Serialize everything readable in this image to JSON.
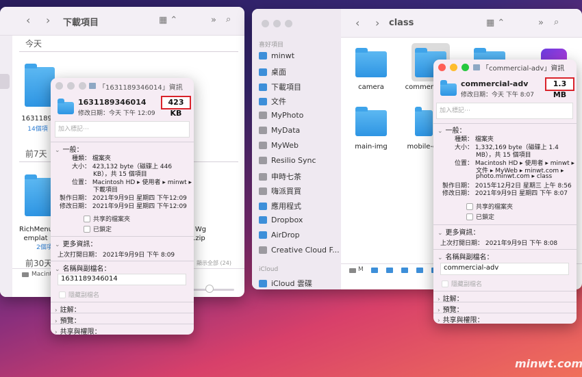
{
  "watermark": "minwt.com",
  "left_finder": {
    "title": "下載項目",
    "group_today": "今天",
    "group_7days": "前7天",
    "group_30days": "前30天",
    "file1_name": "163118934",
    "file1_sub": "14個項",
    "file2_name_a": "RichMenu_",
    "file2_name_b": "emplat",
    "file2_sub": "2個項",
    "file3_name_a": "Wg",
    "file3_name_b": ".zip",
    "show_all": "顯示全部 (24)",
    "path": "Macintosh"
  },
  "left_info": {
    "title": "「1631189346014」資訊",
    "name": "1631189346014",
    "size_badge": "423 KB",
    "modified_line": "修改日期：今天 下午 12:09",
    "tags_placeholder": "加入標記⋯",
    "general_label": "一般：",
    "kind_key": "種類：",
    "kind_val": "檔案夾",
    "size_key": "大小：",
    "size_val1": "423,132 byte（磁碟上 446",
    "size_val2": "KB），共 15 個項目",
    "where_key": "位置：",
    "where_val1": "Macintosh HD ▸ 使用者 ▸ minwt ▸",
    "where_val2": "下載項目",
    "created_key": "製作日期：",
    "created_val": "2021年9月9日 星期四 下午12:09",
    "mod_key": "修改日期：",
    "mod_val": "2021年9月9日 星期四 下午12:09",
    "shared_label": "共享的檔案夾",
    "locked_label": "已鎖定",
    "more_label": "更多資訊：",
    "last_opened": "上次打開日期：  2021年9月9日 下午 8:09",
    "name_ext_label": "名稱與副檔名：",
    "name_field": "1631189346014",
    "hide_ext": "隱藏副檔名",
    "comments": "註解：",
    "preview": "預覽：",
    "sharing": "共享與權限："
  },
  "right_finder": {
    "title": "class",
    "sidebar_favorites": "喜好項目",
    "sidebar": [
      "minwt",
      "桌面",
      "下載項目",
      "文件",
      "MyPhoto",
      "MyData",
      "MyWeb",
      "Resilio Sync",
      "申時七茶",
      "嗨派買買",
      "應用程式",
      "Dropbox",
      "AirDrop",
      "Creative Cloud F..."
    ],
    "sidebar_icloud": "iCloud",
    "icloud_drive": "iCloud 雲碟",
    "items": [
      "camera",
      "commerc",
      "main-img",
      "mobile-c"
    ],
    "path_first": "M"
  },
  "right_info": {
    "title": "「commercial-adv」資訊",
    "name": "commercial-adv",
    "size_badge": "1.3 MB",
    "modified_line": "修改日期：今天 下午 8:07",
    "tags_placeholder": "加入標記⋯",
    "general_label": "一般：",
    "kind_key": "種類：",
    "kind_val": "檔案夾",
    "size_key": "大小：",
    "size_val1": "1,332,169 byte（磁碟上 1.4",
    "size_val2": "MB），共 15 個項目",
    "where_key": "位置：",
    "where_val1": "Macintosh HD ▸ 使用者 ▸ minwt ▸",
    "where_val2": "文件 ▸ MyWeb ▸ minwt.com ▸",
    "where_val3": "photo.minwt.com ▸ class",
    "created_key": "製作日期：",
    "created_val": "2015年12月2日 星期三 上午 8:56",
    "mod_key": "修改日期：",
    "mod_val": "2021年9月9日 星期四 下午 8:07",
    "shared_label": "共享的檔案夾",
    "locked_label": "已鎖定",
    "more_label": "更多資訊：",
    "last_opened": "上次打開日期：  2021年9月9日 下午 8:08",
    "name_ext_label": "名稱與副檔名：",
    "name_field": "commercial-adv",
    "hide_ext": "隱藏副檔名",
    "comments": "註解：",
    "preview": "預覽：",
    "sharing": "共享與權限："
  }
}
